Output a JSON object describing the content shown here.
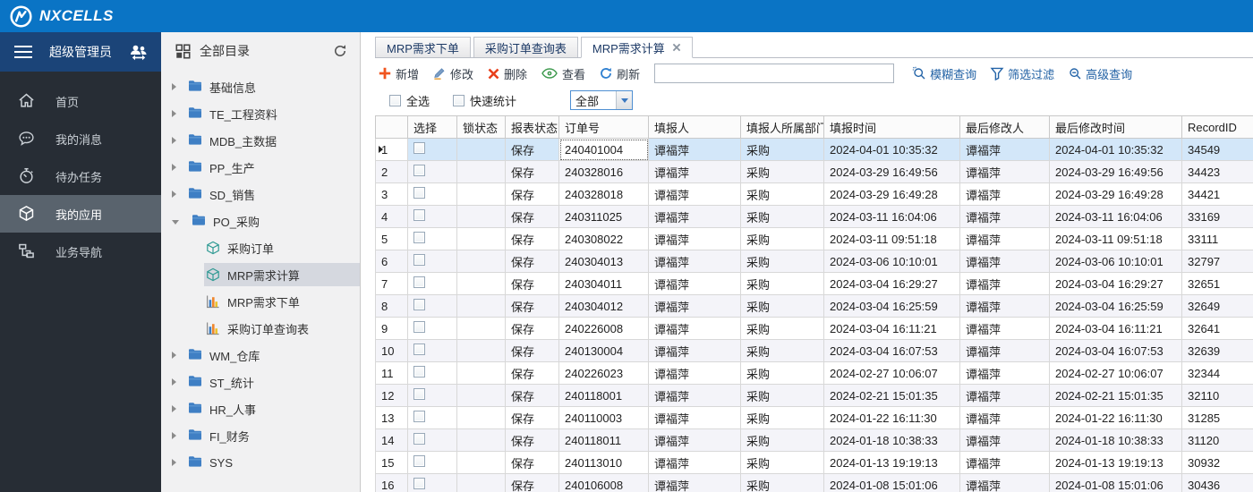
{
  "topbar": {
    "brand": "NXCELLS",
    "bg_color": "#0a74c5"
  },
  "sidebar": {
    "role": "超级管理员",
    "items": [
      {
        "key": "home",
        "label": "首页",
        "icon": "home-icon",
        "selected": false
      },
      {
        "key": "messages",
        "label": "我的消息",
        "icon": "chat-icon",
        "selected": false
      },
      {
        "key": "tasks",
        "label": "待办任务",
        "icon": "clock-icon",
        "selected": false
      },
      {
        "key": "apps",
        "label": "我的应用",
        "icon": "cube-icon",
        "selected": true
      },
      {
        "key": "nav",
        "label": "业务导航",
        "icon": "flow-icon",
        "selected": false
      }
    ]
  },
  "catalog": {
    "title": "全部目录",
    "items": [
      {
        "label": "基础信息",
        "type": "folder",
        "level": 0,
        "expand": "collapsed",
        "selected": false
      },
      {
        "label": "TE_工程资料",
        "type": "folder",
        "level": 0,
        "expand": "collapsed",
        "selected": false
      },
      {
        "label": "MDB_主数据",
        "type": "folder",
        "level": 0,
        "expand": "collapsed",
        "selected": false
      },
      {
        "label": "PP_生产",
        "type": "folder",
        "level": 0,
        "expand": "collapsed",
        "selected": false
      },
      {
        "label": "SD_销售",
        "type": "folder",
        "level": 0,
        "expand": "collapsed",
        "selected": false
      },
      {
        "label": "PO_采购",
        "type": "folder",
        "level": 0,
        "expand": "expanded",
        "selected": false
      },
      {
        "label": "采购订单",
        "type": "module",
        "level": 1,
        "expand": "none",
        "selected": false
      },
      {
        "label": "MRP需求计算",
        "type": "module",
        "level": 1,
        "expand": "none",
        "selected": true
      },
      {
        "label": "MRP需求下单",
        "type": "report",
        "level": 1,
        "expand": "none",
        "selected": false
      },
      {
        "label": "采购订单查询表",
        "type": "report",
        "level": 1,
        "expand": "none",
        "selected": false
      },
      {
        "label": "WM_仓库",
        "type": "folder",
        "level": 0,
        "expand": "collapsed",
        "selected": false
      },
      {
        "label": "ST_统计",
        "type": "folder",
        "level": 0,
        "expand": "collapsed",
        "selected": false
      },
      {
        "label": "HR_人事",
        "type": "folder",
        "level": 0,
        "expand": "collapsed",
        "selected": false
      },
      {
        "label": "FI_财务",
        "type": "folder",
        "level": 0,
        "expand": "collapsed",
        "selected": false
      },
      {
        "label": "SYS",
        "type": "folder",
        "level": 0,
        "expand": "collapsed",
        "selected": false
      }
    ]
  },
  "tabs": [
    {
      "label": "MRP需求下单",
      "active": false,
      "closable": false
    },
    {
      "label": "采购订单查询表",
      "active": false,
      "closable": false
    },
    {
      "label": "MRP需求计算",
      "active": true,
      "closable": true
    }
  ],
  "toolbar": {
    "buttons": [
      {
        "key": "add",
        "label": "新增",
        "icon": "plus-icon"
      },
      {
        "key": "edit",
        "label": "修改",
        "icon": "pencil-icon"
      },
      {
        "key": "delete",
        "label": "删除",
        "icon": "delete-icon"
      },
      {
        "key": "view",
        "label": "查看",
        "icon": "eye-icon"
      },
      {
        "key": "refresh",
        "label": "刷新",
        "icon": "refresh-icon"
      }
    ],
    "search_value": "",
    "links": [
      {
        "key": "fuzzy-query",
        "label": "模糊查询",
        "icon": "fuzzy-search-icon"
      },
      {
        "key": "filter",
        "label": "筛选过滤",
        "icon": "funnel-icon"
      },
      {
        "key": "advanced-query",
        "label": "高级查询",
        "icon": "advanced-search-icon"
      }
    ]
  },
  "filter_row": {
    "select_all_label": "全选",
    "quick_stats_label": "快速统计",
    "dropdown_value": "全部"
  },
  "table": {
    "columns": [
      "选择",
      "锁状态",
      "报表状态",
      "订单号",
      "填报人",
      "填报人所属部门",
      "填报时间",
      "最后修改人",
      "最后修改时间",
      "RecordID"
    ],
    "rows": [
      {
        "num": 1,
        "status": "保存",
        "order": "240401004",
        "person": "谭福萍",
        "dept": "采购",
        "time": "2024-04-01 10:35:32",
        "modifier": "谭福萍",
        "mtime": "2024-04-01 10:35:32",
        "record_id": "34549",
        "selected": true
      },
      {
        "num": 2,
        "status": "保存",
        "order": "240328016",
        "person": "谭福萍",
        "dept": "采购",
        "time": "2024-03-29 16:49:56",
        "modifier": "谭福萍",
        "mtime": "2024-03-29 16:49:56",
        "record_id": "34423",
        "selected": false
      },
      {
        "num": 3,
        "status": "保存",
        "order": "240328018",
        "person": "谭福萍",
        "dept": "采购",
        "time": "2024-03-29 16:49:28",
        "modifier": "谭福萍",
        "mtime": "2024-03-29 16:49:28",
        "record_id": "34421",
        "selected": false
      },
      {
        "num": 4,
        "status": "保存",
        "order": "240311025",
        "person": "谭福萍",
        "dept": "采购",
        "time": "2024-03-11 16:04:06",
        "modifier": "谭福萍",
        "mtime": "2024-03-11 16:04:06",
        "record_id": "33169",
        "selected": false
      },
      {
        "num": 5,
        "status": "保存",
        "order": "240308022",
        "person": "谭福萍",
        "dept": "采购",
        "time": "2024-03-11 09:51:18",
        "modifier": "谭福萍",
        "mtime": "2024-03-11 09:51:18",
        "record_id": "33111",
        "selected": false
      },
      {
        "num": 6,
        "status": "保存",
        "order": "240304013",
        "person": "谭福萍",
        "dept": "采购",
        "time": "2024-03-06 10:10:01",
        "modifier": "谭福萍",
        "mtime": "2024-03-06 10:10:01",
        "record_id": "32797",
        "selected": false
      },
      {
        "num": 7,
        "status": "保存",
        "order": "240304011",
        "person": "谭福萍",
        "dept": "采购",
        "time": "2024-03-04 16:29:27",
        "modifier": "谭福萍",
        "mtime": "2024-03-04 16:29:27",
        "record_id": "32651",
        "selected": false
      },
      {
        "num": 8,
        "status": "保存",
        "order": "240304012",
        "person": "谭福萍",
        "dept": "采购",
        "time": "2024-03-04 16:25:59",
        "modifier": "谭福萍",
        "mtime": "2024-03-04 16:25:59",
        "record_id": "32649",
        "selected": false
      },
      {
        "num": 9,
        "status": "保存",
        "order": "240226008",
        "person": "谭福萍",
        "dept": "采购",
        "time": "2024-03-04 16:11:21",
        "modifier": "谭福萍",
        "mtime": "2024-03-04 16:11:21",
        "record_id": "32641",
        "selected": false
      },
      {
        "num": 10,
        "status": "保存",
        "order": "240130004",
        "person": "谭福萍",
        "dept": "采购",
        "time": "2024-03-04 16:07:53",
        "modifier": "谭福萍",
        "mtime": "2024-03-04 16:07:53",
        "record_id": "32639",
        "selected": false
      },
      {
        "num": 11,
        "status": "保存",
        "order": "240226023",
        "person": "谭福萍",
        "dept": "采购",
        "time": "2024-02-27 10:06:07",
        "modifier": "谭福萍",
        "mtime": "2024-02-27 10:06:07",
        "record_id": "32344",
        "selected": false
      },
      {
        "num": 12,
        "status": "保存",
        "order": "240118001",
        "person": "谭福萍",
        "dept": "采购",
        "time": "2024-02-21 15:01:35",
        "modifier": "谭福萍",
        "mtime": "2024-02-21 15:01:35",
        "record_id": "32110",
        "selected": false
      },
      {
        "num": 13,
        "status": "保存",
        "order": "240110003",
        "person": "谭福萍",
        "dept": "采购",
        "time": "2024-01-22 16:11:30",
        "modifier": "谭福萍",
        "mtime": "2024-01-22 16:11:30",
        "record_id": "31285",
        "selected": false
      },
      {
        "num": 14,
        "status": "保存",
        "order": "240118011",
        "person": "谭福萍",
        "dept": "采购",
        "time": "2024-01-18 10:38:33",
        "modifier": "谭福萍",
        "mtime": "2024-01-18 10:38:33",
        "record_id": "31120",
        "selected": false
      },
      {
        "num": 15,
        "status": "保存",
        "order": "240113010",
        "person": "谭福萍",
        "dept": "采购",
        "time": "2024-01-13 19:19:13",
        "modifier": "谭福萍",
        "mtime": "2024-01-13 19:19:13",
        "record_id": "30932",
        "selected": false
      },
      {
        "num": 16,
        "status": "保存",
        "order": "240106008",
        "person": "谭福萍",
        "dept": "采购",
        "time": "2024-01-08 15:01:06",
        "modifier": "谭福萍",
        "mtime": "2024-01-08 15:01:06",
        "record_id": "30436",
        "selected": false
      }
    ]
  }
}
